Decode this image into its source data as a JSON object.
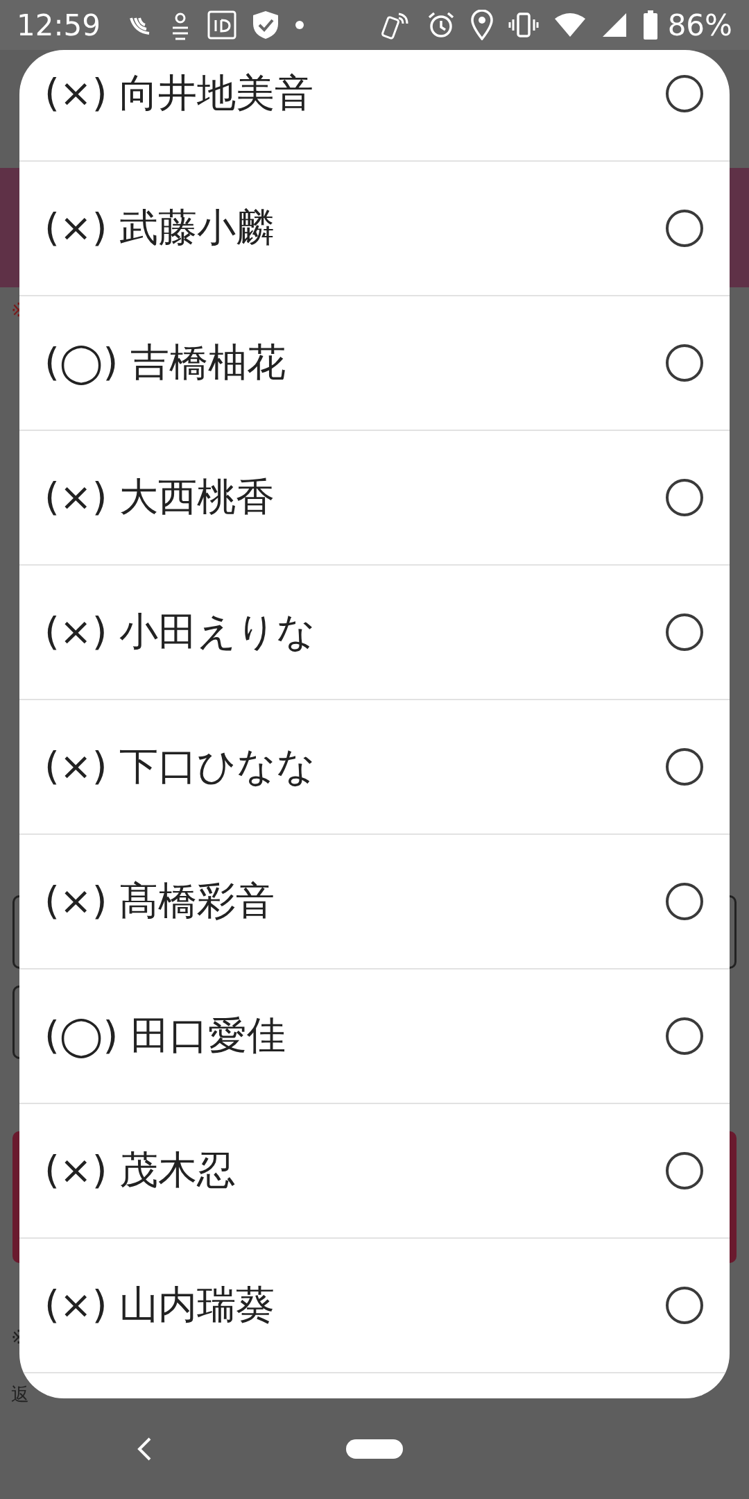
{
  "status_bar": {
    "time": "12:59",
    "battery": "86%"
  },
  "background_page": {
    "notes": [
      "※",
      "※",
      "返"
    ]
  },
  "picker": {
    "options": [
      {
        "label": "(×) 向井地美音",
        "selected": false
      },
      {
        "label": "(×) 武藤小麟",
        "selected": false
      },
      {
        "label": "(◯) 吉橋柚花",
        "selected": false
      },
      {
        "label": "(×) 大西桃香",
        "selected": false
      },
      {
        "label": "(×) 小田えりな",
        "selected": false
      },
      {
        "label": "(×) 下口ひなな",
        "selected": false
      },
      {
        "label": "(×) 髙橋彩音",
        "selected": false
      },
      {
        "label": "(◯) 田口愛佳",
        "selected": false
      },
      {
        "label": "(×) 茂木忍",
        "selected": false
      },
      {
        "label": "(×) 山内瑞葵",
        "selected": false
      }
    ]
  }
}
